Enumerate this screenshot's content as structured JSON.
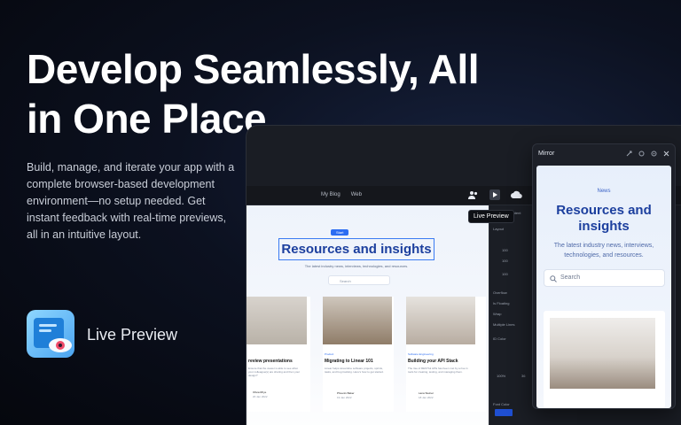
{
  "hero": {
    "title": "Develop Seamlessly, All in One Place",
    "description": "Build, manage, and iterate your app with a complete browser-based development environment—no setup needed. Get instant feedback with real-time previews, all in an intuitive layout."
  },
  "feature": {
    "label": "Live Preview",
    "icon": "live-preview-icon"
  },
  "editor": {
    "nav": [
      "My Blog",
      "Web"
    ],
    "tooltip": "Live Preview",
    "canvas": {
      "badge": "Start",
      "heading": "Resources and insights",
      "subtitle": "The latest industry news, interviews, technologies, and resources.",
      "search_placeholder": "Search",
      "cards": [
        {
          "tag": "",
          "title": "review presentations",
          "excerpt": "Ensure that the viewer is able to see what your colleague(s) are sharing and then your design?",
          "author": "Olivia Rhye",
          "date": "20 Jan 2022"
        },
        {
          "tag": "Product",
          "title": "Migrating to Linear 101",
          "excerpt": "Linear helps streamline software projects, sprints, tasks, and bug tracking. Here's how to get started.",
          "author": "Phoenix Baker",
          "date": "19 Jan 2022"
        },
        {
          "tag": "Software Engineering",
          "title": "Building your API Stack",
          "excerpt": "The rise of RESTful APIs has been met by a rise in tools for creating, testing, and managing them.",
          "author": "Lana Steiner",
          "date": "18 Jan 2022"
        }
      ]
    },
    "inspector": {
      "tabs": [
        "Design",
        "Content"
      ],
      "sections": [
        "Layout",
        "Overflow",
        "Is Floating",
        "Wrap",
        "Multiple Lines",
        "ID Color",
        "Font Color"
      ],
      "values": [
        "100",
        "100",
        "100",
        "100%",
        "36"
      ],
      "color": "#1F4FD1"
    }
  },
  "mirror": {
    "title": "Mirror",
    "badge": "News",
    "heading": "Resources and insights",
    "subtitle": "The latest industry news, interviews, technologies, and resources.",
    "search_placeholder": "Search"
  }
}
